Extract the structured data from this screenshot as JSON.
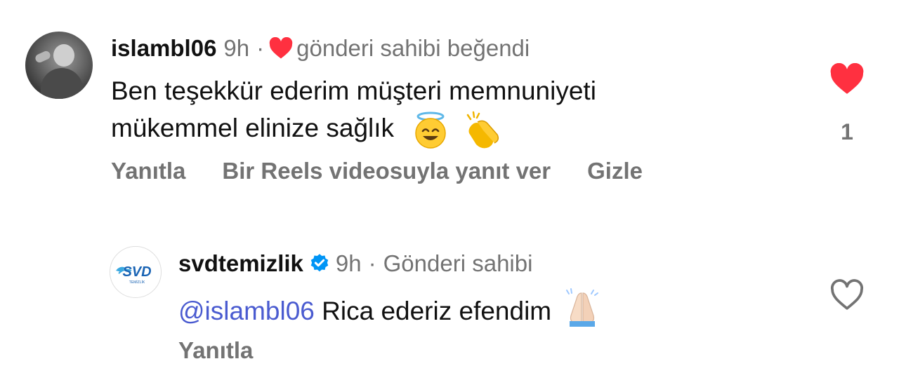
{
  "comment": {
    "username": "islambl06",
    "time": "9h",
    "separator": "·",
    "liked_note": "gönderi sahibi beğendi",
    "text_line1": "Ben teşekkür ederim müşteri memnuniyeti",
    "text_line2": "mükemmel elinize sağlık",
    "emojis": [
      "smiling-face-with-halo",
      "clapping-hands"
    ],
    "actions": {
      "reply": "Yanıtla",
      "reels_reply": "Bir Reels videosuyla yanıt ver",
      "hide": "Gizle"
    },
    "like_count": "1",
    "liked": true
  },
  "reply": {
    "username": "svdtemizlik",
    "verified": true,
    "time": "9h",
    "separator": "·",
    "role": "Gönderi sahibi",
    "mention": "@islambl06",
    "text": "Rica ederiz efendim",
    "emoji": "folded-hands",
    "avatar_logo_text": "SVD",
    "avatar_logo_subtext": "TEMİZLİK",
    "actions": {
      "reply": "Yanıtla"
    },
    "liked": false
  },
  "colors": {
    "like_red": "#ff3040",
    "meta_gray": "#737373",
    "mention_blue": "#4a5bd0",
    "verified_blue": "#0095f6",
    "brand_blue": "#1a64b4"
  }
}
